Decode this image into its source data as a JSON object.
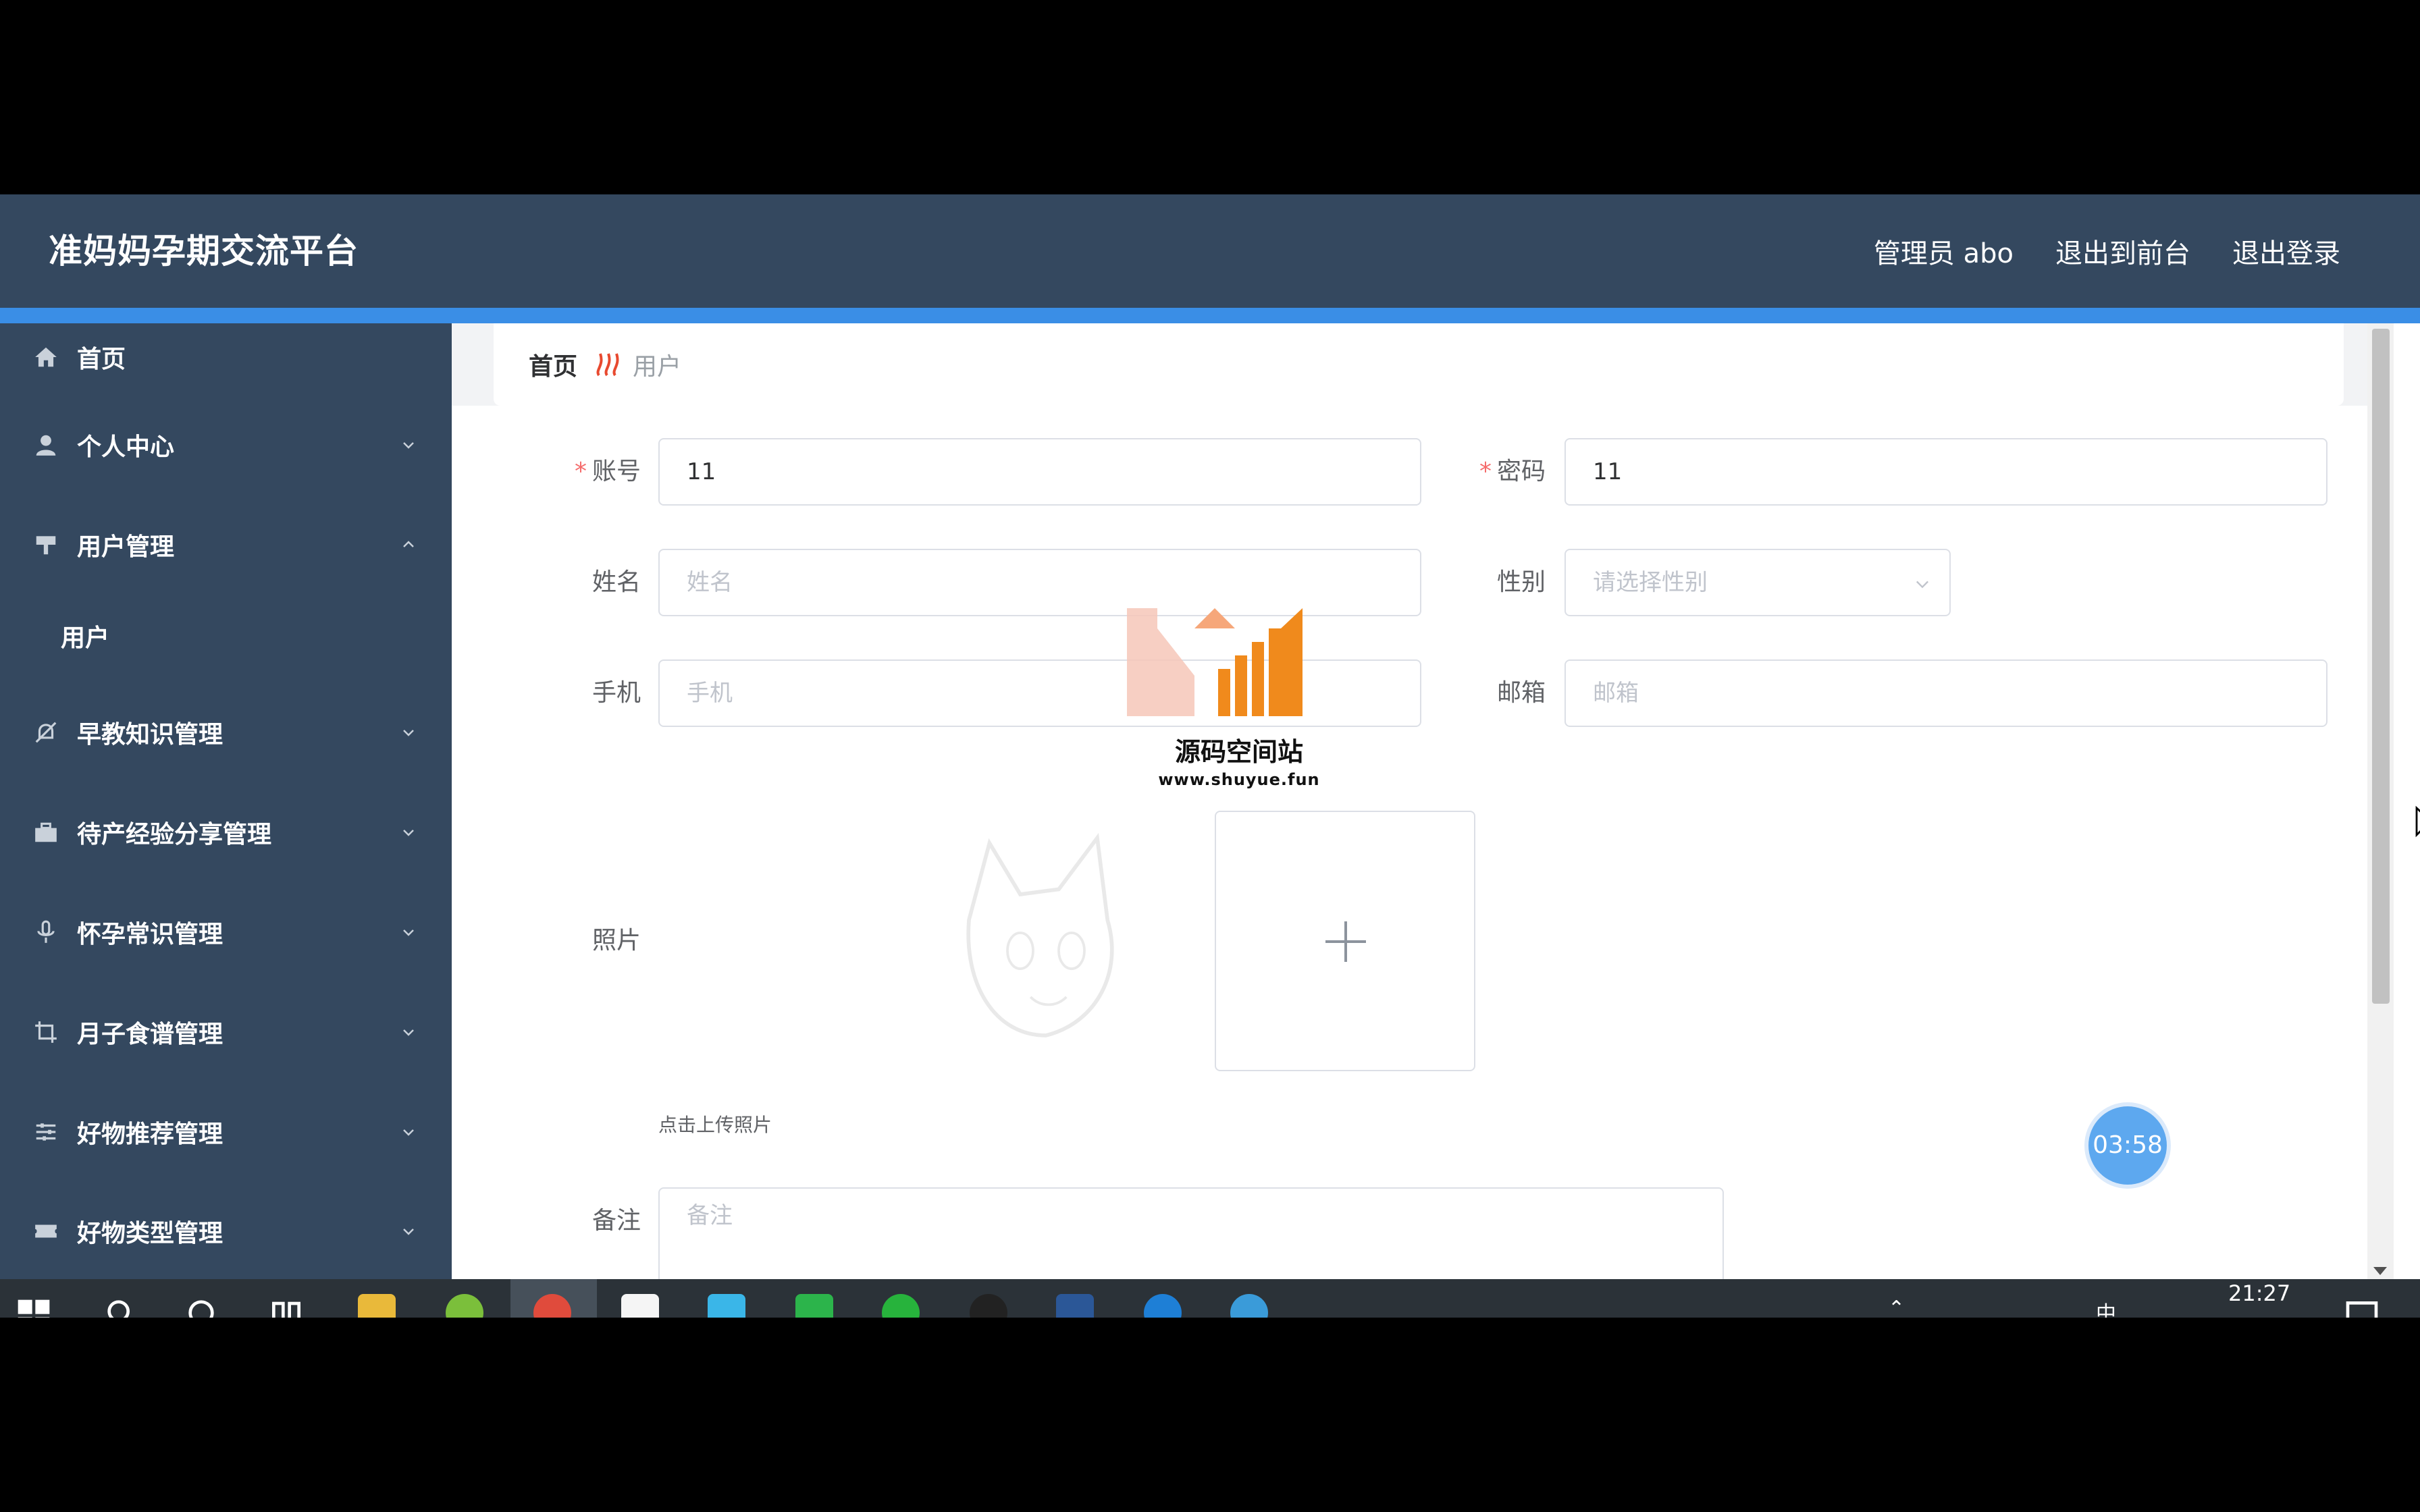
{
  "header": {
    "title": "准妈妈孕期交流平台",
    "user": "管理员 abo",
    "to_front": "退出到前台",
    "logout": "退出登录"
  },
  "sidebar": {
    "items": [
      {
        "label": "首页",
        "icon": "home-icon"
      },
      {
        "label": "个人中心",
        "icon": "user-icon"
      },
      {
        "label": "用户管理",
        "icon": "signpost-icon",
        "expanded": true
      },
      {
        "label": "用户",
        "sub": true
      },
      {
        "label": "早教知识管理",
        "icon": "bell-off-icon"
      },
      {
        "label": "待产经验分享管理",
        "icon": "briefcase-icon"
      },
      {
        "label": "怀孕常识管理",
        "icon": "microphone-icon"
      },
      {
        "label": "月子食谱管理",
        "icon": "crop-icon"
      },
      {
        "label": "好物推荐管理",
        "icon": "sliders-icon"
      },
      {
        "label": "好物类型管理",
        "icon": "ticket-icon"
      }
    ]
  },
  "breadcrumb": {
    "home": "首页",
    "current": "用户"
  },
  "form": {
    "account_label": "账号",
    "account_value": "11",
    "password_label": "密码",
    "password_value": "11",
    "name_label": "姓名",
    "name_placeholder": "姓名",
    "gender_label": "性别",
    "gender_placeholder": "请选择性别",
    "phone_label": "手机",
    "phone_placeholder": "手机",
    "email_label": "邮箱",
    "email_placeholder": "邮箱",
    "photo_label": "照片",
    "upload_hint": "点击上传照片",
    "remark_label": "备注",
    "remark_placeholder": "备注"
  },
  "watermark": {
    "title": "源码空间站",
    "url": "www.shuyue.fun"
  },
  "timer": "03:58",
  "taskbar": {
    "time": "21:27",
    "ime": "中"
  },
  "colors": {
    "header_bg": "#34485f",
    "accent": "#3a8ee6",
    "required": "#f56c6c"
  }
}
